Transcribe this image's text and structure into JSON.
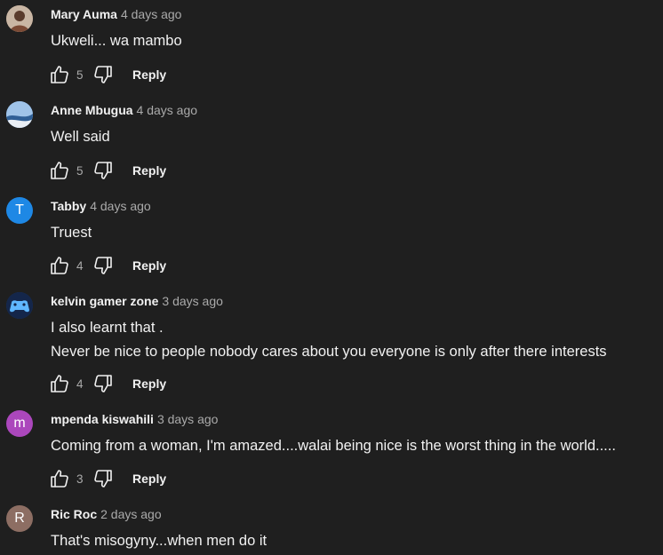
{
  "comments": [
    {
      "author": "Mary Auma",
      "time": "4 days ago",
      "lines": [
        "Ukweli... wa mambo"
      ],
      "likes": "5",
      "reply_label": "Reply",
      "avatar": {
        "type": "photo",
        "color": "#8a6a55"
      }
    },
    {
      "author": "Anne Mbugua",
      "time": "4 days ago",
      "lines": [
        "Well said"
      ],
      "likes": "5",
      "reply_label": "Reply",
      "avatar": {
        "type": "photo",
        "color": "#3f6ea8"
      }
    },
    {
      "author": "Tabby",
      "time": "4 days ago",
      "lines": [
        "Truest"
      ],
      "likes": "4",
      "reply_label": "Reply",
      "avatar": {
        "type": "letter",
        "letter": "T",
        "color": "#1e88e5"
      }
    },
    {
      "author": "kelvin gamer zone",
      "time": "3 days ago",
      "lines": [
        "I also learnt that  .",
        "Never be nice to people nobody cares about you everyone is only after there interests"
      ],
      "likes": "4",
      "reply_label": "Reply",
      "avatar": {
        "type": "photo",
        "color": "#1d3b66"
      }
    },
    {
      "author": "mpenda kiswahili",
      "time": "3 days ago",
      "lines": [
        "Coming from a woman, I'm amazed....walai being nice is the worst thing in the world....."
      ],
      "likes": "3",
      "reply_label": "Reply",
      "avatar": {
        "type": "letter",
        "letter": "m",
        "color": "#ab47bc"
      }
    },
    {
      "author": "Ric Roc",
      "time": "2 days ago",
      "lines": [
        "That's misogyny...when men do it"
      ],
      "likes": null,
      "reply_label": null,
      "avatar": {
        "type": "letter",
        "letter": "R",
        "color": "#8d6e63"
      }
    }
  ]
}
